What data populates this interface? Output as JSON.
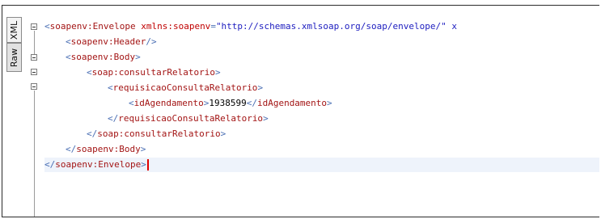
{
  "side_tabs": {
    "xml_label": "XML",
    "raw_label": "Raw"
  },
  "editor": {
    "l1": {
      "open": "<",
      "name": "soapenv:Envelope",
      "attr": " xmlns:soapenv",
      "eq": "=",
      "value": "\"http://schemas.xmlsoap.org/soap/envelope/\"",
      "trail": " x"
    },
    "l2": {
      "open": "<",
      "name": "soapenv:Header",
      "close": "/>"
    },
    "l3": {
      "open": "<",
      "name": "soapenv:Body",
      "close": ">"
    },
    "l4": {
      "open": "<",
      "name": "soap:consultarRelatorio",
      "close": ">"
    },
    "l5": {
      "open": "<",
      "name": "requisicaoConsultaRelatorio",
      "close": ">"
    },
    "l6": {
      "open": "<",
      "name": "idAgendamento",
      "close": ">",
      "text": "1938599",
      "end_open": "</",
      "end_name": "idAgendamento",
      "end_close": ">"
    },
    "l7": {
      "open": "</",
      "name": "requisicaoConsultaRelatorio",
      "close": ">"
    },
    "l8": {
      "open": "</",
      "name": "soap:consultarRelatorio",
      "close": ">"
    },
    "l9": {
      "open": "</",
      "name": "soapenv:Body",
      "close": ">"
    },
    "l10": {
      "open": "</",
      "name": "soapenv:Envelope",
      "close": ">"
    }
  },
  "colors": {
    "tag": "#a31515",
    "attribute": "#c00000",
    "attribute_value": "#2020c0",
    "caret": "#e00000"
  }
}
